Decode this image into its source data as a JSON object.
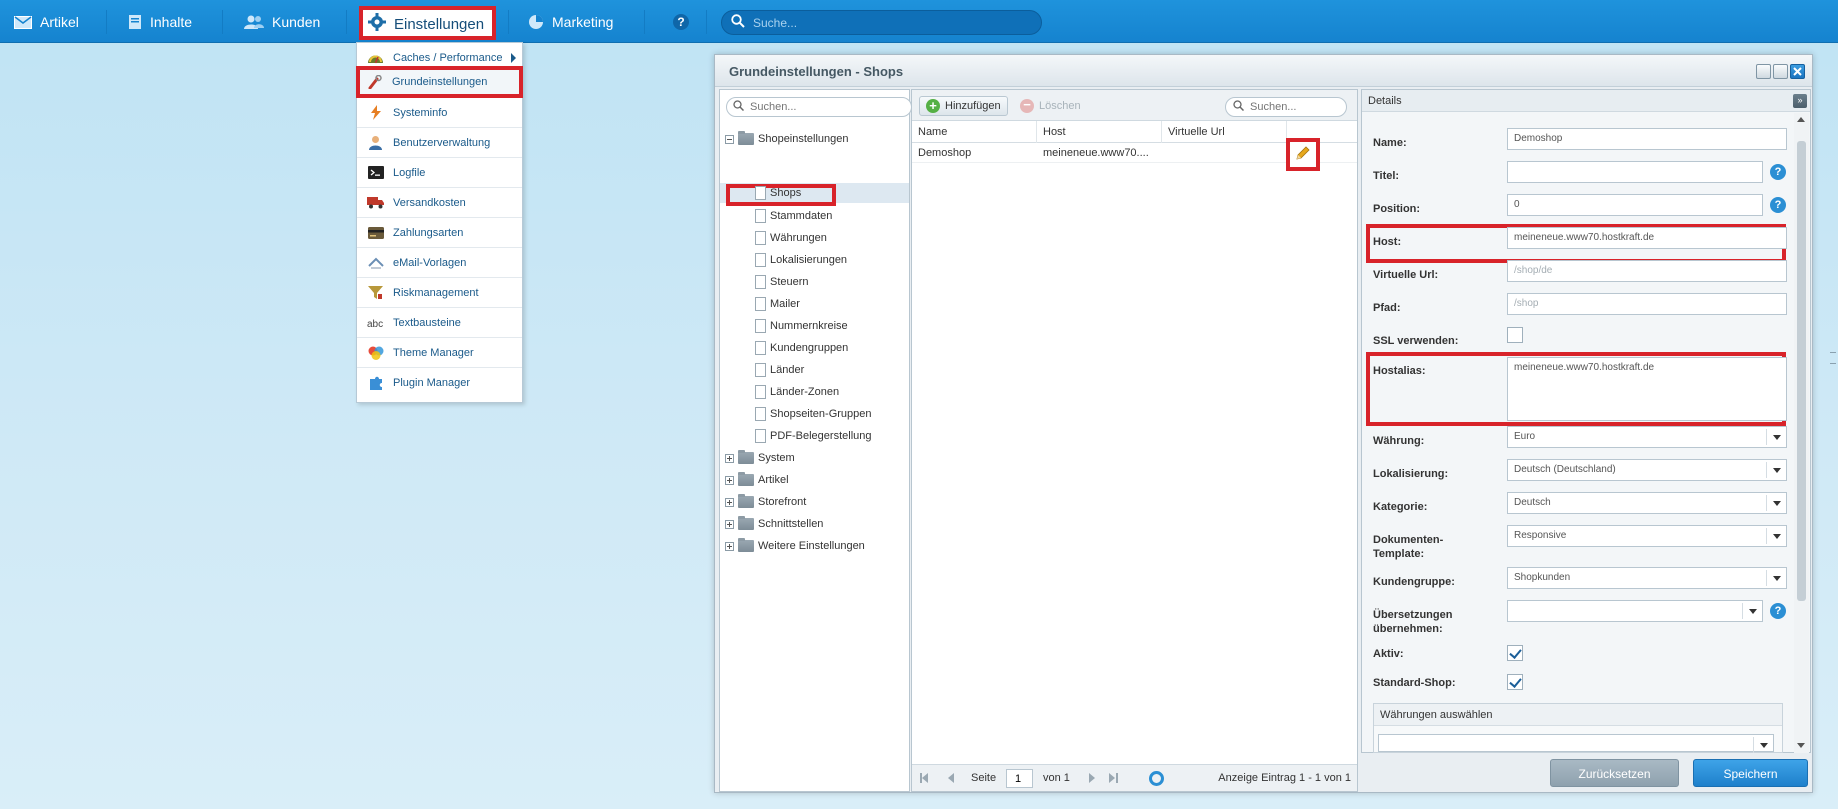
{
  "nav": {
    "items": [
      {
        "label": "Artikel",
        "icon": "mail-icon"
      },
      {
        "label": "Inhalte",
        "icon": "document-icon"
      },
      {
        "label": "Kunden",
        "icon": "users-icon"
      },
      {
        "label": "Einstellungen",
        "icon": "gear-icon"
      },
      {
        "label": "Marketing",
        "icon": "pie-chart-icon"
      },
      {
        "label": "",
        "icon": "help-icon"
      }
    ],
    "search_placeholder": "Suche..."
  },
  "menu": {
    "items": [
      {
        "label": "Caches / Performance",
        "icon": "speedometer-icon",
        "submenu": true
      },
      {
        "label": "Grundeinstellungen",
        "icon": "wrench-icon"
      },
      {
        "label": "Systeminfo",
        "icon": "lightning-icon"
      },
      {
        "label": "Benutzerverwaltung",
        "icon": "user-icon"
      },
      {
        "label": "Logfile",
        "icon": "terminal-icon"
      },
      {
        "label": "Versandkosten",
        "icon": "truck-icon"
      },
      {
        "label": "Zahlungsarten",
        "icon": "credit-card-icon"
      },
      {
        "label": "eMail-Vorlagen",
        "icon": "email-template-icon"
      },
      {
        "label": "Riskmanagement",
        "icon": "funnel-icon"
      },
      {
        "label": "Textbausteine",
        "icon": "abc-icon"
      },
      {
        "label": "Theme Manager",
        "icon": "palette-icon"
      },
      {
        "label": "Plugin Manager",
        "icon": "puzzle-icon"
      }
    ]
  },
  "window": {
    "title": "Grundeinstellungen - Shops",
    "tree": {
      "search_placeholder": "Suchen...",
      "root": "Shopeinstellungen",
      "children": [
        "Shops",
        "Stammdaten",
        "Währungen",
        "Lokalisierungen",
        "Steuern",
        "Mailer",
        "Nummernkreise",
        "Kundengruppen",
        "Länder",
        "Länder-Zonen",
        "Shopseiten-Gruppen",
        "PDF-Belegerstellung"
      ],
      "folders": [
        "System",
        "Artikel",
        "Storefront",
        "Schnittstellen",
        "Weitere Einstellungen"
      ]
    },
    "grid": {
      "add_label": "Hinzufügen",
      "delete_label": "Löschen",
      "search_placeholder": "Suchen...",
      "columns": [
        "Name",
        "Host",
        "Virtuelle Url"
      ],
      "rows": [
        {
          "name": "Demoshop",
          "host": "meineneue.www70....",
          "url": ""
        }
      ],
      "pager": {
        "page_label": "Seite",
        "page_value": "1",
        "of_label": "von 1",
        "info": "Anzeige Eintrag 1 - 1 von 1"
      }
    },
    "details": {
      "header": "Details",
      "fields": {
        "name_label": "Name:",
        "name_value": "Demoshop",
        "title_label": "Titel:",
        "title_value": "",
        "position_label": "Position:",
        "position_value": "0",
        "host_label": "Host:",
        "host_value": "meineneue.www70.hostkraft.de",
        "vurl_label": "Virtuelle Url:",
        "vurl_placeholder": "/shop/de",
        "path_label": "Pfad:",
        "path_placeholder": "/shop",
        "ssl_label": "SSL verwenden:",
        "hostalias_label": "Hostalias:",
        "hostalias_value": "meineneue.www70.hostkraft.de",
        "currency_label": "Währung:",
        "currency_value": "Euro",
        "locale_label": "Lokalisierung:",
        "locale_value": "Deutsch (Deutschland)",
        "category_label": "Kategorie:",
        "category_value": "Deutsch",
        "doc_template_label_1": "Dokumenten-",
        "doc_template_label_2": "Template:",
        "doc_template_value": "Responsive",
        "customer_group_label": "Kundengruppe:",
        "customer_group_value": "Shopkunden",
        "translations_label_1": "Übersetzungen",
        "translations_label_2": "übernehmen:",
        "translations_value": "",
        "active_label": "Aktiv:",
        "standard_shop_label": "Standard-Shop:",
        "currencies_section": "Währungen auswählen"
      },
      "checkbox_states": {
        "ssl": false,
        "active": true,
        "standard_shop": true
      }
    },
    "reset_label": "Zurücksetzen",
    "save_label": "Speichern"
  },
  "colors": {
    "topbar": "#1583cf",
    "highlight": "#d8232a",
    "accent": "#2b8fd4"
  }
}
